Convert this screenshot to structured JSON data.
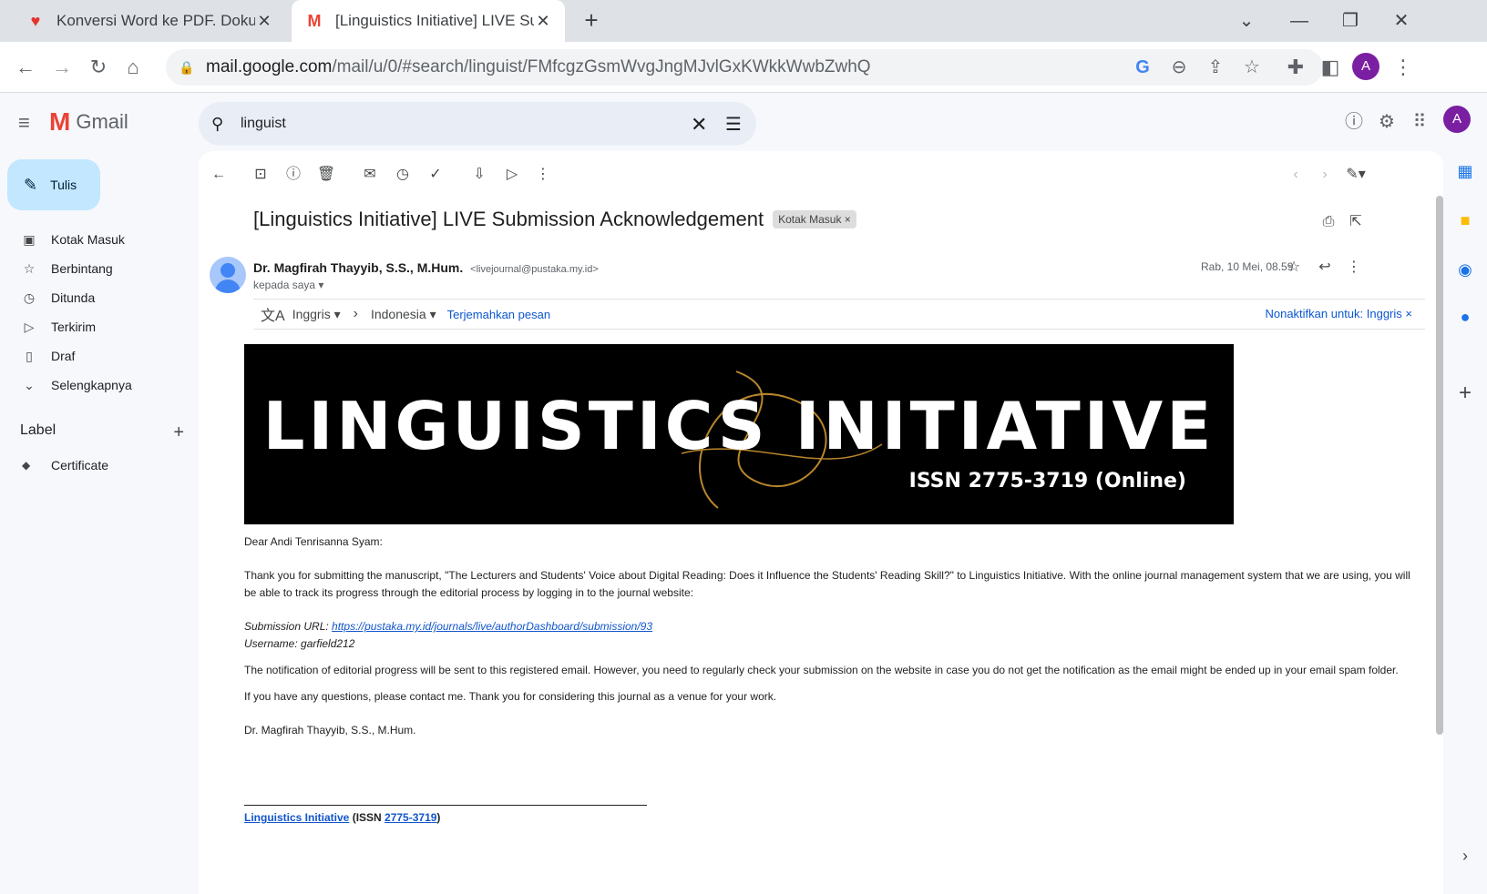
{
  "browser": {
    "tabs": [
      {
        "title": "Konversi Word ke PDF. Dokumen",
        "favicon": "heart-icon"
      },
      {
        "title": "[Linguistics Initiative] LIVE Submi",
        "favicon": "gmail-icon"
      }
    ],
    "url_host": "mail.google.com",
    "url_path": "/mail/u/0/#search/linguist/FMfcgzGsmWvgJngMJvlGxKWkkWwbZwhQ",
    "avatar_letter": "A"
  },
  "gmail": {
    "app_name": "Gmail",
    "search_value": "linguist",
    "compose_label": "Tulis",
    "nav": [
      {
        "label": "Kotak Masuk",
        "icon": "inbox-icon"
      },
      {
        "label": "Berbintang",
        "icon": "star-icon"
      },
      {
        "label": "Ditunda",
        "icon": "clock-icon"
      },
      {
        "label": "Terkirim",
        "icon": "send-icon"
      },
      {
        "label": "Draf",
        "icon": "draft-icon"
      },
      {
        "label": "Selengkapnya",
        "icon": "chevron-down-icon"
      }
    ],
    "labels_header": "Label",
    "labels": [
      {
        "label": "Certificate"
      }
    ],
    "avatar_letter": "A"
  },
  "email": {
    "subject": "[Linguistics Initiative] LIVE Submission Acknowledgement",
    "chip": "Kotak Masuk",
    "sender_name": "Dr. Magfirah Thayyib, S.S., M.Hum.",
    "sender_email": "<livejournal@pustaka.my.id>",
    "to": "kepada saya",
    "date": "Rab, 10 Mei, 08.59",
    "translate": {
      "from": "Inggris",
      "to": "Indonesia",
      "translate_link": "Terjemahkan pesan",
      "disable": "Nonaktifkan untuk: Inggris"
    },
    "banner_title": "LINGUISTICS INITIATIVE",
    "banner_issn": "ISSN 2775-3719 (Online)",
    "greeting": "Dear Andi Tenrisanna Syam:",
    "para1": "Thank you for submitting the manuscript, \"The Lecturers and Students' Voice about Digital Reading: Does it Influence the Students' Reading Skill?\" to Linguistics Initiative. With the online journal management system that we are using, you will be able to track its progress through the editorial process by logging in to the journal website:",
    "submission_label": "Submission URL: ",
    "submission_url": "https://pustaka.my.id/journals/live/authorDashboard/submission/93",
    "username_line": "Username: garfield212",
    "para2": "The notification of editorial progress will be sent to this registered email. However, you need to regularly check your submission on the website in case you do not get the notification as the email might be ended up in your email spam folder.",
    "para3": "If you have any questions, please contact me. Thank you for considering this journal as a venue for your work.",
    "signature": "Dr. Magfirah Thayyib, S.S., M.Hum.",
    "footer_journal": "Linguistics Initiative",
    "footer_issn_prefix": " (ISSN ",
    "footer_issn": "2775-3719",
    "footer_suffix": ")"
  }
}
